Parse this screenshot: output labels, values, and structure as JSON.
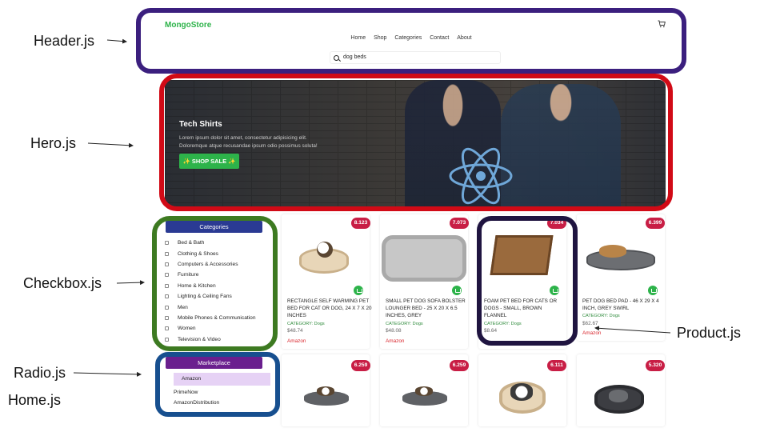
{
  "annotations": {
    "header": "Header.js",
    "hero": "Hero.js",
    "checkbox": "Checkbox.js",
    "product": "Product.js",
    "radio": "Radio.js",
    "home": "Home.js"
  },
  "colors": {
    "header_box": "#3b1f7e",
    "hero_box": "#d10a16",
    "checkbox_box": "#3d7a21",
    "product_box": "#1f1440",
    "radio_box": "#174f8f",
    "brand": "#2db34a",
    "badge": "#c81e45"
  },
  "header": {
    "brand": "MongoStore",
    "cart_icon": "cart-icon",
    "nav": [
      "Home",
      "Shop",
      "Categories",
      "Contact",
      "About"
    ],
    "search_value": "dog beds",
    "search_icon": "search-icon"
  },
  "hero": {
    "title": "Tech Shirts",
    "text_line1": "Lorem ipsum dolor sit amet, consectetur adipisicing elit.",
    "text_line2": "Doloremque atque recusandae ipsum odio possimus soluta!",
    "button": "✨ SHOP SALE ✨"
  },
  "categories": {
    "title": "Categories",
    "items": [
      "Bed & Bath",
      "Clothing & Shoes",
      "Computers & Accessories",
      "Furniture",
      "Home & Kitchen",
      "Lighting & Ceiling Fans",
      "Men",
      "Mobile Phones & Communication",
      "Women",
      "Television & Video"
    ]
  },
  "marketplace": {
    "title": "Marketplace",
    "selected": "Amazon",
    "options": [
      "PrimeNow",
      "AmazonDistribution"
    ]
  },
  "products": [
    {
      "rating": "8.123",
      "title": "RECTANGLE SELF WARMING PET BED FOR CAT OR DOG, 24 X 7 X 20 INCHES",
      "category": "CATEGORY: Dogs",
      "price": "$48.74",
      "seller": "Amazon"
    },
    {
      "rating": "7.073",
      "title": "SMALL PET DOG SOFA BOLSTER LOUNGER BED - 25 X 20 X 6.5 INCHES, GREY",
      "category": "CATEGORY: Dogs",
      "price": "$48.08",
      "seller": "Amazon"
    },
    {
      "rating": "7.034",
      "title": "FOAM PET BED FOR CATS OR DOGS - SMALL, BROWN FLANNEL",
      "category": "CATEGORY: Dogs",
      "price": "$8.64",
      "seller": ""
    },
    {
      "rating": "6.399",
      "title": "PET DOG BED PAD - 46 X 29 X 4 INCH, GREY SWIRL",
      "category": "CATEGORY: Dogs",
      "price": "$62.67",
      "seller": "Amazon"
    },
    {
      "rating": "6.259"
    },
    {
      "rating": "6.259"
    },
    {
      "rating": "6.111"
    },
    {
      "rating": "5.320"
    }
  ]
}
